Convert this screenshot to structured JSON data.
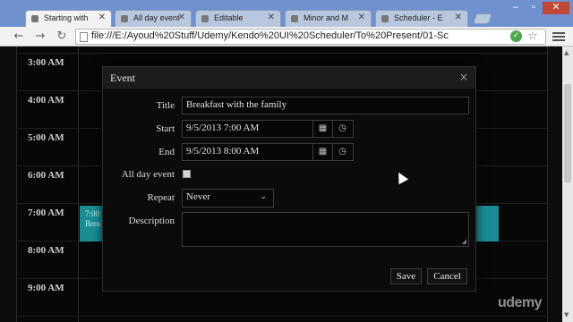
{
  "browser": {
    "tabs": [
      {
        "label": "Starting with",
        "active": true
      },
      {
        "label": "All day event",
        "active": false
      },
      {
        "label": "Editable",
        "active": false
      },
      {
        "label": "Minor and M",
        "active": false
      },
      {
        "label": "Scheduler - E",
        "active": false
      }
    ],
    "window_buttons": {
      "minimize": "–",
      "maximize": "▫",
      "close": "✕"
    },
    "address": "file:///E:/Ayoud%20Stuff/Udemy/Kendo%20UI%20Scheduler/To%20Present/01-Sc",
    "nav": {
      "back": "←",
      "forward": "→",
      "reload": "↻"
    }
  },
  "scheduler": {
    "times": [
      "3:00 AM",
      "4:00 AM",
      "5:00 AM",
      "6:00 AM",
      "7:00 AM",
      "8:00 AM",
      "9:00 AM"
    ],
    "event": {
      "time": "7:00",
      "title": "Brea"
    }
  },
  "dialog": {
    "title": "Event",
    "close": "×",
    "labels": {
      "title": "Title",
      "start": "Start",
      "end": "End",
      "all_day": "All day event",
      "repeat": "Repeat",
      "description": "Description"
    },
    "values": {
      "title": "Breakfast with the family",
      "start": "9/5/2013 7:00 AM",
      "end": "9/5/2013 8:00 AM",
      "repeat": "Never",
      "description": ""
    },
    "all_day_checked": false,
    "buttons": {
      "save": "Save",
      "cancel": "Cancel"
    }
  },
  "icons": {
    "calendar": "calendar-icon",
    "clock": "clock-icon"
  },
  "watermark": "udemy",
  "colors": {
    "event": "#1a8d94",
    "tabbar": "#6f91cf",
    "close_button": "#c24836"
  }
}
